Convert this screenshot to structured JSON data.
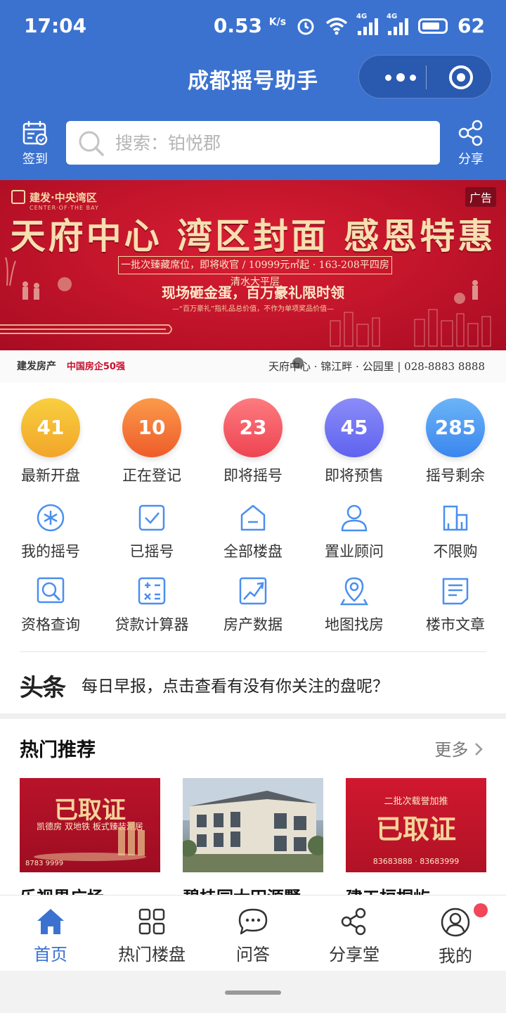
{
  "status_bar": {
    "time": "17:04",
    "speed": "0.53",
    "speed_unit": "K/s",
    "sim1": "4G",
    "sim2": "4G",
    "battery": "62"
  },
  "header": {
    "title": "成都摇号助手",
    "checkin_label": "签到",
    "share_label": "分享",
    "search_placeholder": "搜索：铂悦郡",
    "brand_color": "#3b72d0"
  },
  "banner": {
    "brand": "建发·中央湾区",
    "brand_en": "CENTER·OF·THE BAY",
    "ad_tag": "广告",
    "headline": "天府中心 湾区封面 感恩特惠",
    "line1": "一批次臻藏席位，即将收官 / 10999元㎡起 · 163-208平四房清水大平层",
    "line2": "现场砸金蛋，百万豪礼限时领",
    "line3": "—“百万豪礼”指礼品总价值，不作为单项奖品价值—",
    "footer_brand": "建发房产",
    "footer_slogan": "中国房企50强",
    "footer_right": "天府中心 · 锦江畔 · 公园里 | 028-8883 8888"
  },
  "stats": [
    {
      "value": "41",
      "label": "最新开盘",
      "color_from": "#f8cf3f",
      "color_to": "#f2a52a"
    },
    {
      "value": "10",
      "label": "正在登记",
      "color_from": "#fb9a4a",
      "color_to": "#ee5c2a"
    },
    {
      "value": "23",
      "label": "即将摇号",
      "color_from": "#fd7b7f",
      "color_to": "#ee4452"
    },
    {
      "value": "45",
      "label": "即将预售",
      "color_from": "#8b8cf8",
      "color_to": "#5f63ef"
    },
    {
      "value": "285",
      "label": "摇号剩余",
      "color_from": "#6bb4f7",
      "color_to": "#3b86ee"
    }
  ],
  "grid": [
    {
      "label": "我的摇号",
      "icon": "snowflake-icon"
    },
    {
      "label": "已摇号",
      "icon": "checkbox-icon"
    },
    {
      "label": "全部楼盘",
      "icon": "house-icon"
    },
    {
      "label": "置业顾问",
      "icon": "person-icon"
    },
    {
      "label": "不限购",
      "icon": "buildings-icon"
    },
    {
      "label": "资格查询",
      "icon": "search-doc-icon"
    },
    {
      "label": "贷款计算器",
      "icon": "calculator-icon"
    },
    {
      "label": "房产数据",
      "icon": "trend-chart-icon"
    },
    {
      "label": "地图找房",
      "icon": "map-pin-icon"
    },
    {
      "label": "楼市文章",
      "icon": "article-icon"
    }
  ],
  "news": {
    "logo": "头条",
    "text": "每日早报，点击查看有没有你关注的盘呢？"
  },
  "hot": {
    "title": "热门推荐",
    "more": "更多",
    "cards": [
      {
        "name": "乐视界广场",
        "big": "已取证",
        "small": "凯德房 双地铁 板式臻装湖居",
        "phone": "8783 9999"
      },
      {
        "name": "碧桂园大田源墅",
        "big": "",
        "small": "",
        "phone": ""
      },
      {
        "name": "建工桓桐屿",
        "big": "已取证",
        "small": "二批次载誉加推",
        "phone": "83683888 · 83683999"
      }
    ]
  },
  "tabbar": [
    {
      "label": "首页",
      "icon": "home-icon",
      "active": true
    },
    {
      "label": "热门楼盘",
      "icon": "grid-icon",
      "active": false
    },
    {
      "label": "问答",
      "icon": "chat-icon",
      "active": false
    },
    {
      "label": "分享堂",
      "icon": "share-icon",
      "active": false
    },
    {
      "label": "我的",
      "icon": "user-circle-icon",
      "active": false
    }
  ]
}
